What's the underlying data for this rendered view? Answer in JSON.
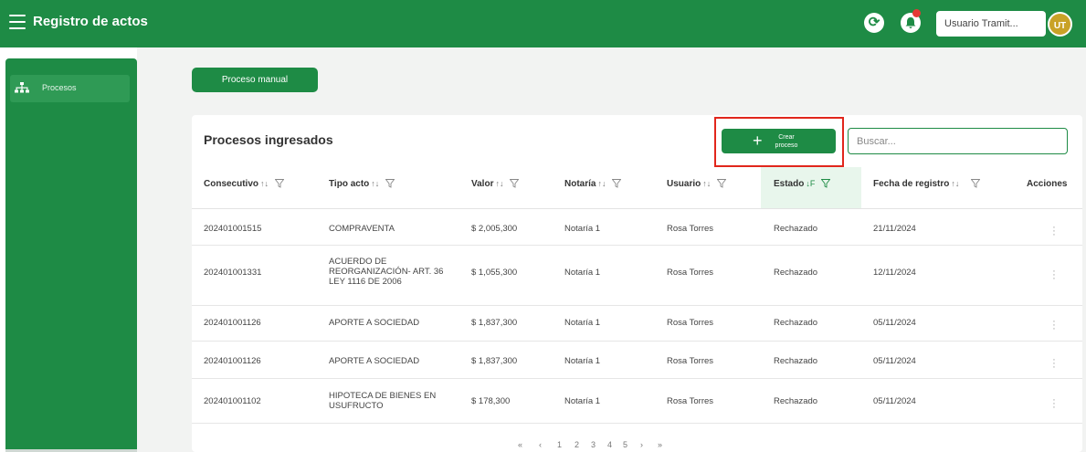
{
  "header": {
    "app_title": "Registro de actos",
    "user_name": "Usuario Tramit...",
    "avatar_initials": "UT",
    "brand_color": "#1e8b45"
  },
  "sidebar": {
    "items": [
      {
        "label": "Procesos",
        "icon": "org-chart-icon"
      }
    ]
  },
  "toolbar": {
    "manual_button": "Proceso manual"
  },
  "card": {
    "title": "Procesos ingresados",
    "create_button": "Crear proceso",
    "search_placeholder": "Buscar..."
  },
  "table": {
    "columns": [
      {
        "label": "Consecutivo",
        "sort": "↑↓"
      },
      {
        "label": "Tipo acto",
        "sort": "↑↓"
      },
      {
        "label": "Valor",
        "sort": "↑↓"
      },
      {
        "label": "Notaría",
        "sort": "↑↓"
      },
      {
        "label": "Usuario",
        "sort": "↑↓"
      },
      {
        "label": "Estado",
        "sort": "↓F"
      },
      {
        "label": "Fecha de registro",
        "sort": "↑↓"
      },
      {
        "label": "Acciones"
      }
    ],
    "rows": [
      {
        "consecutivo": "202401001515",
        "tipo_acto": "COMPRAVENTA",
        "valor": "$ 2,005,300",
        "notaria": "Notaría 1",
        "usuario": "Rosa Torres",
        "estado": "Rechazado",
        "fecha": "21/11/2024"
      },
      {
        "consecutivo": "202401001331",
        "tipo_acto": "ACUERDO DE REORGANIZACIÓN- ART. 36 LEY 1116 DE 2006",
        "valor": "$ 1,055,300",
        "notaria": "Notaría 1",
        "usuario": "Rosa Torres",
        "estado": "Rechazado",
        "fecha": "12/11/2024"
      },
      {
        "consecutivo": "202401001126",
        "tipo_acto": "APORTE A SOCIEDAD",
        "valor": "$ 1,837,300",
        "notaria": "Notaría 1",
        "usuario": "Rosa Torres",
        "estado": "Rechazado",
        "fecha": "05/11/2024"
      },
      {
        "consecutivo": "202401001126",
        "tipo_acto": "APORTE A SOCIEDAD",
        "valor": "$ 1,837,300",
        "notaria": "Notaría 1",
        "usuario": "Rosa Torres",
        "estado": "Rechazado",
        "fecha": "05/11/2024"
      },
      {
        "consecutivo": "202401001102",
        "tipo_acto": "HIPOTECA DE BIENES EN USUFRUCTO",
        "valor": "$ 178,300",
        "notaria": "Notaría 1",
        "usuario": "Rosa Torres",
        "estado": "Rechazado",
        "fecha": "05/11/2024"
      }
    ]
  },
  "pagination": {
    "first": "«",
    "prev": "‹",
    "pages": [
      "1",
      "2",
      "3",
      "4",
      "5"
    ],
    "next": "›",
    "last": "»"
  }
}
